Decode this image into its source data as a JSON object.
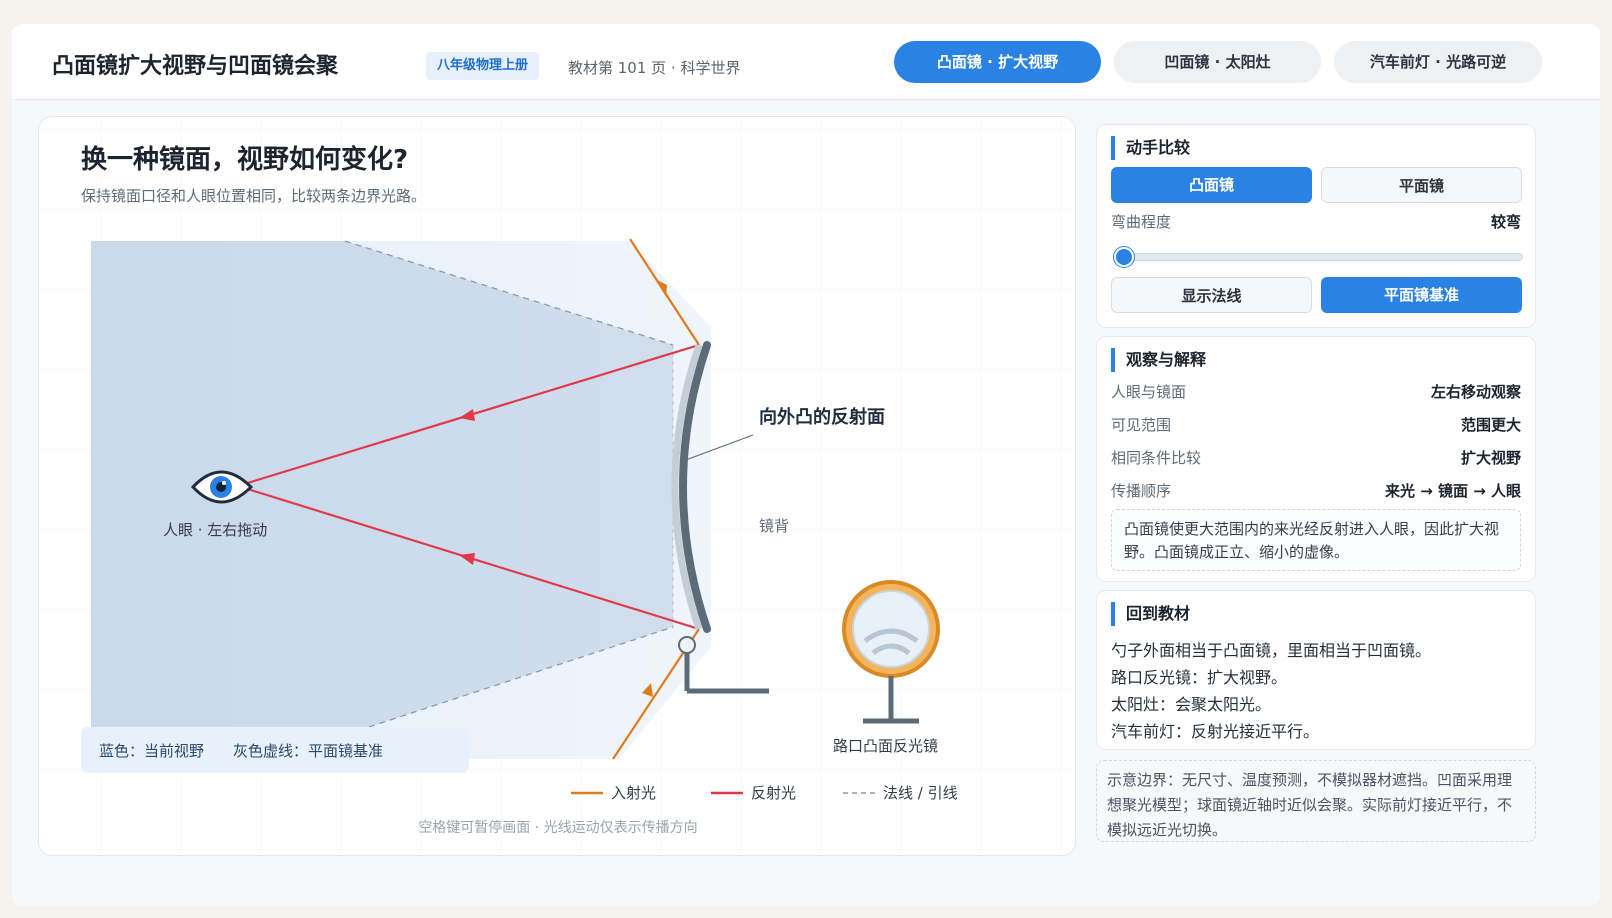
{
  "header": {
    "title": "凸面镜扩大视野与凹面镜会聚",
    "grade_badge": "八年级物理上册",
    "page_ref": "教材第 101 页 · 科学世界",
    "tabs": [
      {
        "label": "凸面镜 · 扩大视野",
        "active": true
      },
      {
        "label": "凹面镜 · 太阳灶",
        "active": false
      },
      {
        "label": "汽车前灯 · 光路可逆",
        "active": false
      }
    ]
  },
  "stage": {
    "title": "换一种镜面，视野如何变化?",
    "subtitle": "保持镜面口径和人眼位置相同，比较两条边界光路。",
    "labels": {
      "eye": "人眼 · 左右拖动",
      "surface": "向外凸的反射面",
      "back": "镜背",
      "road_mirror": "路口凸面反光镜"
    },
    "legend_box": {
      "blue": "蓝色：当前视野",
      "gray": "灰色虚线：平面镜基准"
    },
    "line_legend": {
      "incident": "入射光",
      "reflected": "反射光",
      "normal": "法线 / 引线"
    },
    "footer": "空格键可暂停画面 · 光线运动仅表示传播方向",
    "colors": {
      "incident": "#e07b1a",
      "reflected": "#e0394a",
      "field": "#a9c0dc",
      "accent": "#2a82e4"
    }
  },
  "compare": {
    "title": "动手比较",
    "mirror_options": [
      {
        "label": "凸面镜",
        "active": true
      },
      {
        "label": "平面镜",
        "active": false
      }
    ],
    "curvature_label": "弯曲程度",
    "curvature_value": "较弯",
    "curvature_level": 0,
    "toggles": [
      {
        "label": "显示法线",
        "active": false
      },
      {
        "label": "平面镜基准",
        "active": true
      }
    ]
  },
  "observe": {
    "title": "观察与解释",
    "rows": [
      {
        "label": "人眼与镜面",
        "value": "左右移动观察"
      },
      {
        "label": "可见范围",
        "value": "范围更大"
      },
      {
        "label": "相同条件比较",
        "value": "扩大视野"
      },
      {
        "label": "传播顺序",
        "value": "来光 → 镜面 → 人眼"
      }
    ],
    "note": "凸面镜使更大范围内的来光经反射进入人眼，因此扩大视野。凸面镜成正立、缩小的虚像。"
  },
  "textbook": {
    "title": "回到教材",
    "lines": [
      "勺子外面相当于凸面镜，里面相当于凹面镜。",
      "路口反光镜：扩大视野。",
      "太阳灶：会聚太阳光。",
      "汽车前灯：反射光接近平行。"
    ]
  },
  "disclaimer": "示意边界：无尺寸、温度预测，不模拟器材遮挡。凹面采用理想聚光模型；球面镜近轴时近似会聚。实际前灯接近平行，不模拟远近光切换。"
}
